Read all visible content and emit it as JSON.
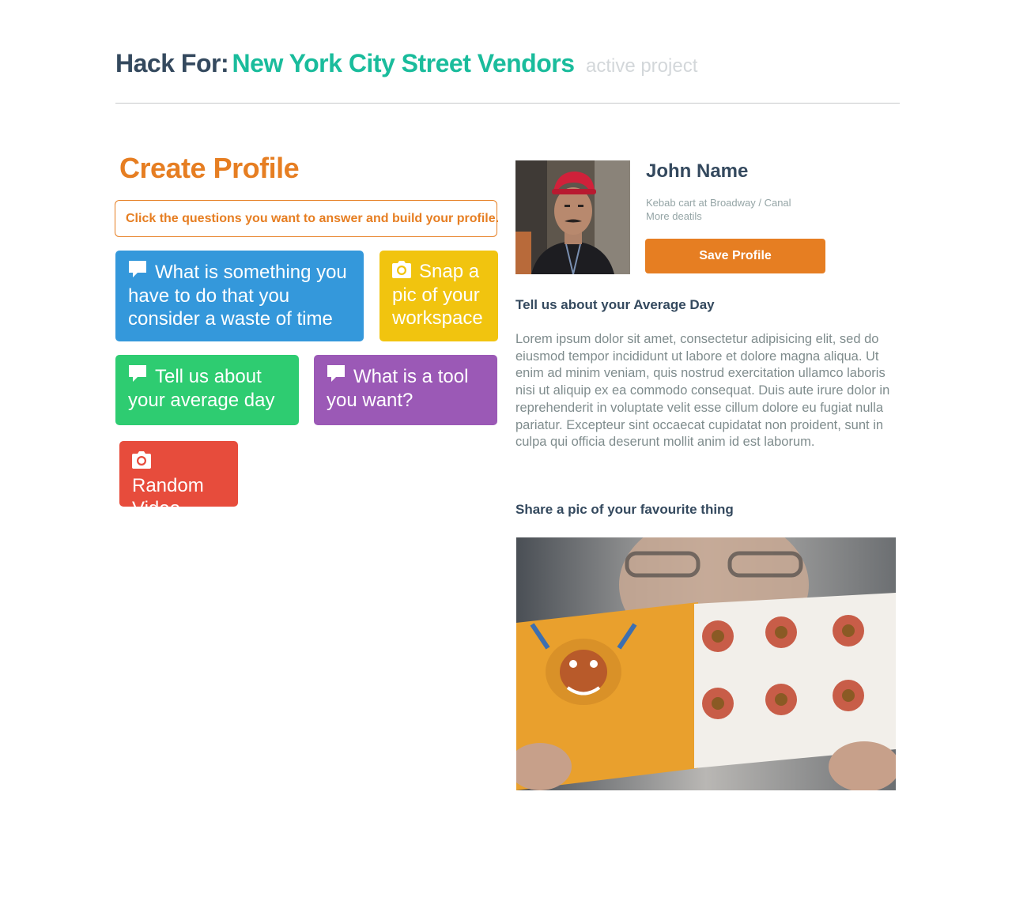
{
  "header": {
    "prefix": "Hack For:",
    "project": "New York City Street Vendors",
    "status": "active project"
  },
  "create": {
    "title": "Create Profile",
    "hint": "Click the questions you want to answer and build your profile."
  },
  "questions": [
    {
      "label": "What is something you have to do that you consider a waste of time",
      "icon": "comment-icon",
      "color": "#3498db"
    },
    {
      "label": "Snap a pic of your workspace",
      "icon": "camera-icon",
      "color": "#f1c40f"
    },
    {
      "label": "Tell us about your average day",
      "icon": "comment-icon",
      "color": "#2ecc71"
    },
    {
      "label": "What is a tool you want?",
      "icon": "comment-icon",
      "color": "#9b59b6"
    },
    {
      "label": "Random Video",
      "icon": "camera-icon",
      "color": "#e74c3c"
    }
  ],
  "profile": {
    "name": "John Name",
    "location": "Kebab cart at Broadway / Canal",
    "more": "More deatils",
    "save_label": "Save Profile"
  },
  "average_day": {
    "heading": "Tell us about your Average Day",
    "answer": "Lorem ipsum dolor sit amet, consectetur adipisicing elit, sed do eiusmod tempor incididunt ut labore et dolore magna aliqua. Ut enim ad minim veniam, quis nostrud exercitation ullamco laboris nisi ut aliquip ex ea commodo consequat. Duis aute irure dolor in reprehenderit in voluptate velit esse cillum dolore eu fugiat nulla pariatur. Excepteur sint occaecat cupidatat non proident, sunt in culpa qui officia deserunt mollit anim id est laborum."
  },
  "favourite": {
    "heading": "Share a pic of your favourite thing"
  },
  "colors": {
    "accent_orange": "#e67e22",
    "teal": "#1abc9c",
    "navy": "#34495e"
  }
}
